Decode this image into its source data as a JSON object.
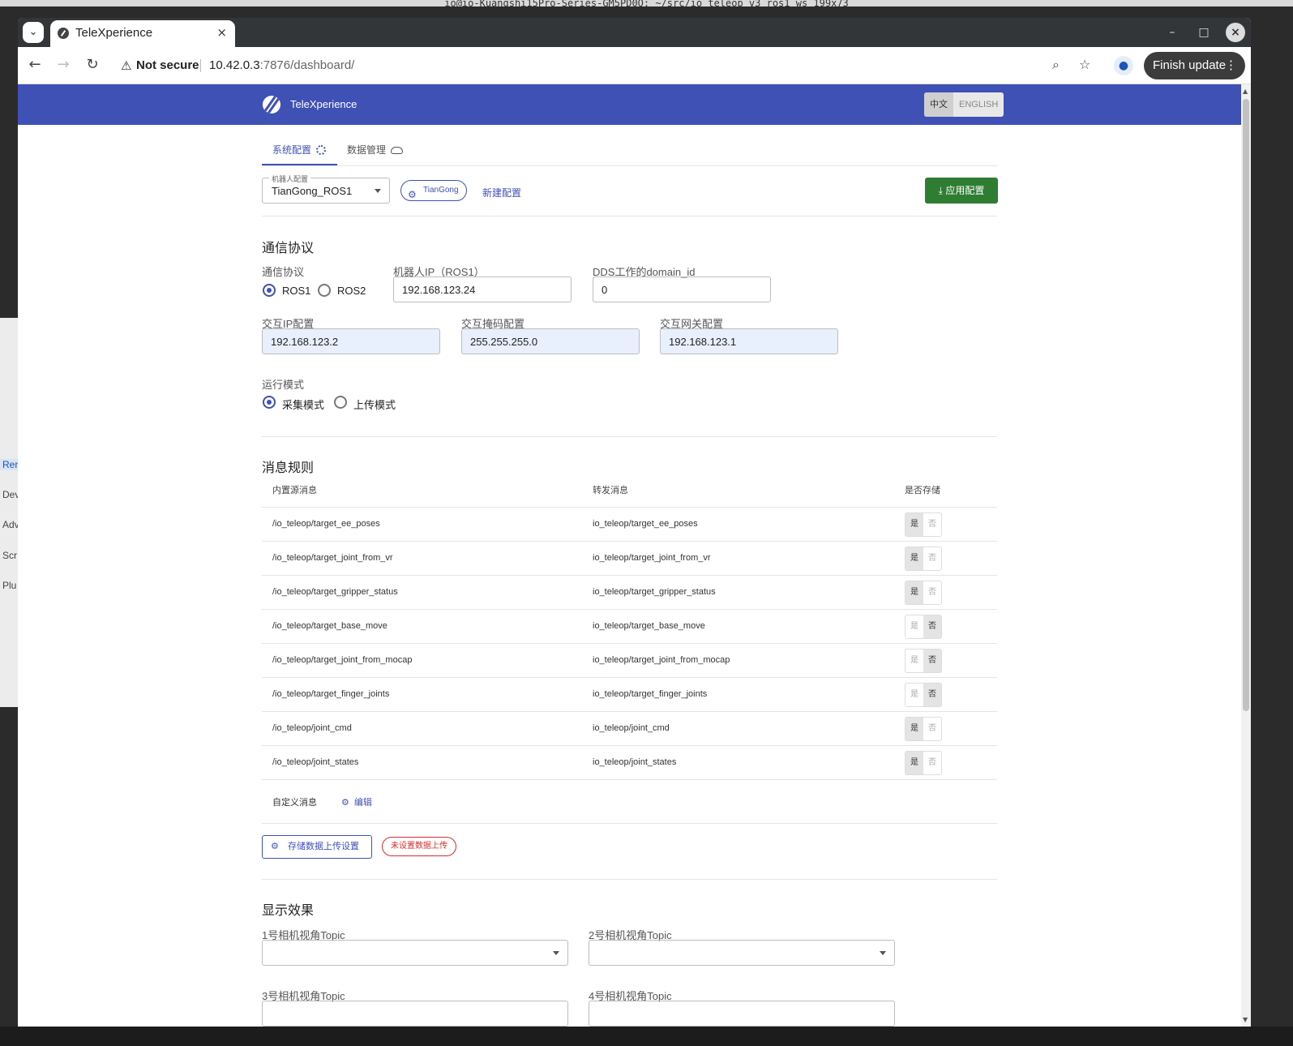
{
  "terminal_title": "io@io-Kuangshi15Pro-Series-GM5PD0O: ~/src/io_teleop_v3_ros1_ws 199x73",
  "side_items": [
    "Rer",
    "Dev",
    "Adv",
    "Scr",
    "Plu"
  ],
  "browser": {
    "tab_title": "TeleXperience",
    "security": "Not secure",
    "url_host": "10.42.0.3",
    "url_rest": ":7876/dashboard/",
    "finish_update": "Finish update"
  },
  "app": {
    "title": "TeleXperience",
    "lang_zh": "中文",
    "lang_en": "ENGLISH"
  },
  "tabs": {
    "system": "系统配置",
    "data": "数据管理"
  },
  "robot_config": {
    "label": "机器人配置",
    "value": "TianGong_ROS1",
    "chip": "TianGong",
    "new_config": "新建配置",
    "apply": "应用配置"
  },
  "comm": {
    "title": "通信协议",
    "protocol_label": "通信协议",
    "ros1": "ROS1",
    "ros2": "ROS2",
    "selected": "ROS1",
    "robot_ip_label": "机器人IP（ROS1）",
    "robot_ip": "192.168.123.24",
    "domain_label": "DDS工作的domain_id",
    "domain_id": "0",
    "ip_label": "交互IP配置",
    "ip": "192.168.123.2",
    "mask_label": "交互掩码配置",
    "mask": "255.255.255.0",
    "gateway_label": "交互网关配置",
    "gateway": "192.168.123.1",
    "mode_label": "运行模式",
    "mode_collect": "采集模式",
    "mode_upload": "上传模式",
    "mode_selected": "采集模式"
  },
  "rules": {
    "title": "消息规则",
    "col_source": "内置源消息",
    "col_forward": "转发消息",
    "col_store": "是否存储",
    "yes": "是",
    "no": "否",
    "rows": [
      {
        "source": "/io_teleop/target_ee_poses",
        "forward": "io_teleop/target_ee_poses",
        "store": true
      },
      {
        "source": "/io_teleop/target_joint_from_vr",
        "forward": "io_teleop/target_joint_from_vr",
        "store": true
      },
      {
        "source": "/io_teleop/target_gripper_status",
        "forward": "io_teleop/target_gripper_status",
        "store": true
      },
      {
        "source": "/io_teleop/target_base_move",
        "forward": "io_teleop/target_base_move",
        "store": false
      },
      {
        "source": "/io_teleop/target_joint_from_mocap",
        "forward": "io_teleop/target_joint_from_mocap",
        "store": false
      },
      {
        "source": "/io_teleop/target_finger_joints",
        "forward": "io_teleop/target_finger_joints",
        "store": false
      },
      {
        "source": "/io_teleop/joint_cmd",
        "forward": "io_teleop/joint_cmd",
        "store": true
      },
      {
        "source": "/io_teleop/joint_states",
        "forward": "io_teleop/joint_states",
        "store": true
      }
    ],
    "custom_label": "自定义消息",
    "edit": "编辑",
    "upload_settings": "存储数据上传设置",
    "upload_status": "未设置数据上传"
  },
  "display": {
    "title": "显示效果",
    "cam1": "1号相机视角Topic",
    "cam2": "2号相机视角Topic",
    "cam3": "3号相机视角Topic",
    "cam4": "4号相机视角Topic"
  },
  "colors": {
    "primary": "#3f51b5",
    "apply": "#2e7d32",
    "warning": "#d32f2f"
  }
}
